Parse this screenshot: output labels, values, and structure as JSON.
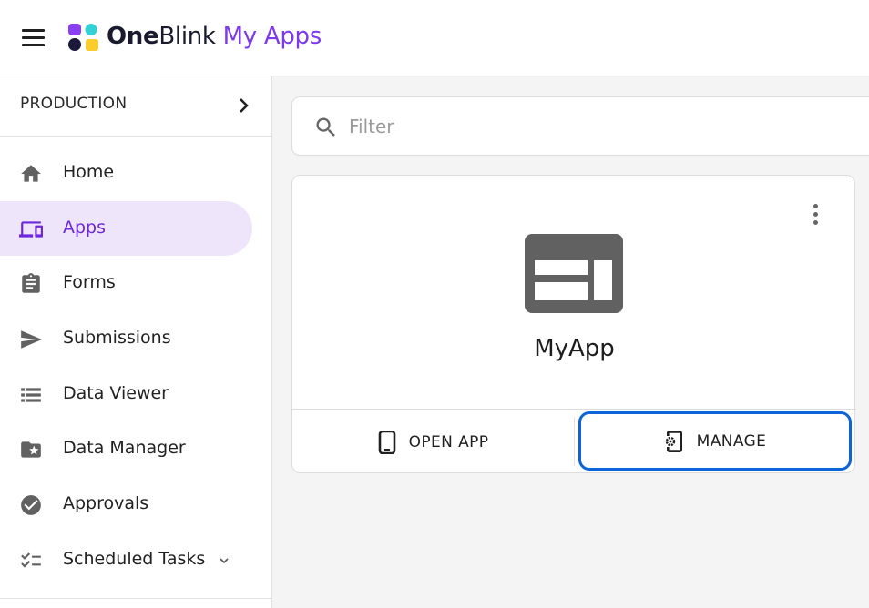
{
  "header": {
    "brand_one": "One",
    "brand_blink": "Blink",
    "brand_product": " My Apps"
  },
  "sidebar": {
    "environment": "PRODUCTION",
    "items": [
      {
        "label": "Home",
        "icon": "home-icon",
        "active": false
      },
      {
        "label": "Apps",
        "icon": "devices-icon",
        "active": true
      },
      {
        "label": "Forms",
        "icon": "clipboard-icon",
        "active": false
      },
      {
        "label": "Submissions",
        "icon": "send-icon",
        "active": false
      },
      {
        "label": "Data Viewer",
        "icon": "list-view-icon",
        "active": false
      },
      {
        "label": "Data Manager",
        "icon": "folder-star-icon",
        "active": false
      },
      {
        "label": "Approvals",
        "icon": "check-circle-icon",
        "active": false
      },
      {
        "label": "Scheduled Tasks",
        "icon": "checklist-icon",
        "active": false
      }
    ]
  },
  "filter": {
    "placeholder": "Filter",
    "value": ""
  },
  "app_card": {
    "name": "MyApp",
    "icon": "web-layout-icon",
    "open_label": "OPEN APP",
    "manage_label": "MANAGE"
  },
  "colors": {
    "accent": "#7c3aed",
    "active_bg": "#efe5fb",
    "focus_ring": "#0d63d8",
    "main_bg": "#f4f4f4"
  }
}
